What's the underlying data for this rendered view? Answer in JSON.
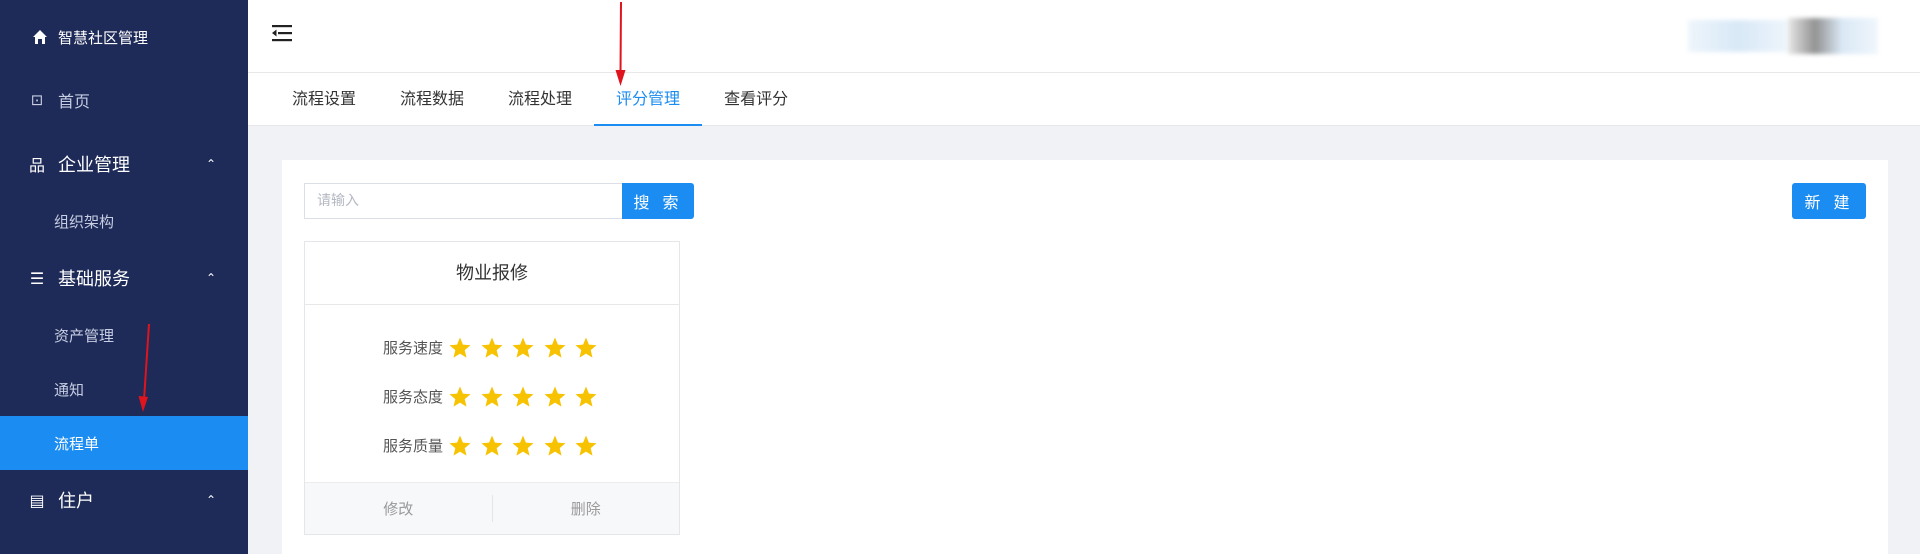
{
  "sidebar": {
    "brand": "智慧社区管理",
    "home": "首页",
    "groups": [
      {
        "label": "企业管理",
        "children": [
          "组织架构"
        ]
      },
      {
        "label": "基础服务",
        "children": [
          "资产管理",
          "通知",
          "流程单"
        ]
      },
      {
        "label": "住户",
        "children": []
      }
    ],
    "active_item": "流程单"
  },
  "tabs": [
    "流程设置",
    "流程数据",
    "流程处理",
    "评分管理",
    "查看评分"
  ],
  "active_tab": "评分管理",
  "toolbar": {
    "search_placeholder": "请输入",
    "search_label": "搜 索",
    "new_label": "新 建"
  },
  "card": {
    "title": "物业报修",
    "ratings": [
      {
        "label": "服务速度",
        "stars": 5
      },
      {
        "label": "服务态度",
        "stars": 5
      },
      {
        "label": "服务质量",
        "stars": 5
      }
    ],
    "edit_label": "修改",
    "delete_label": "删除"
  },
  "colors": {
    "sidebar_bg": "#1e2a57",
    "accent": "#1a8cf2",
    "star": "#f7c200",
    "annotation_arrow": "#e0141e"
  }
}
